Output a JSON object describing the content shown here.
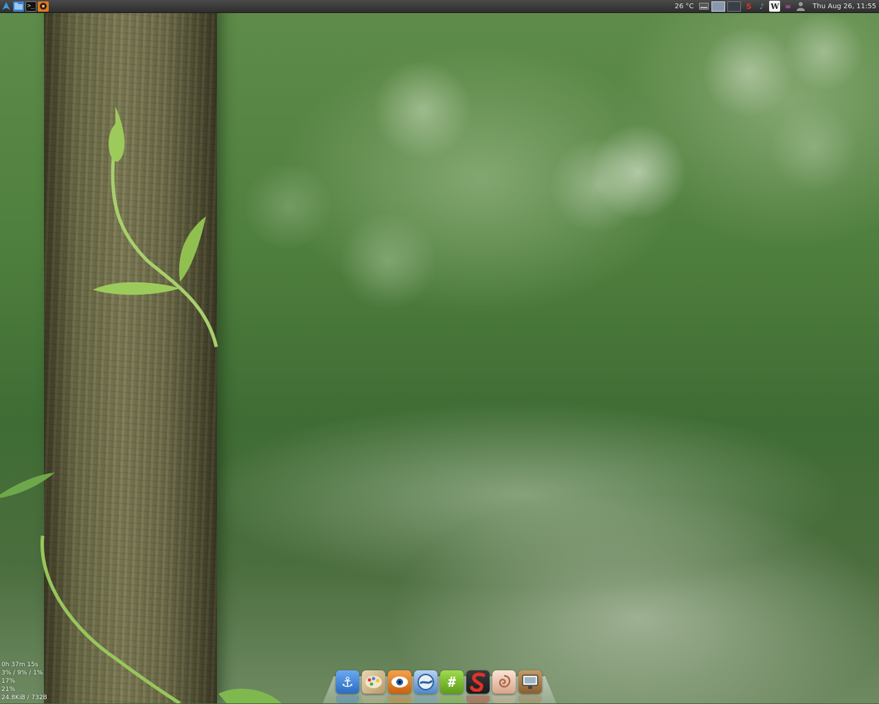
{
  "top_panel": {
    "launchers": [
      {
        "name": "arch-menu-icon"
      },
      {
        "name": "file-manager-icon"
      },
      {
        "name": "terminal-icon"
      },
      {
        "name": "media-player-icon"
      }
    ],
    "temperature": "26 °C",
    "workspaces": [
      {
        "name": "workspace-1",
        "active": true
      },
      {
        "name": "workspace-2",
        "active": false
      }
    ],
    "tray": [
      {
        "name": "scrobbler-icon",
        "glyph": "S",
        "color": "#e0322b"
      },
      {
        "name": "music-note-icon",
        "glyph": "♪",
        "color": "#5aa0e6"
      },
      {
        "name": "wikipedia-icon",
        "glyph": "W",
        "color": "#ffffff"
      },
      {
        "name": "messenger-icon",
        "glyph": "∞",
        "color": "#d64fcf"
      },
      {
        "name": "user-icon",
        "glyph": "●",
        "color": "#9a9a9a"
      }
    ],
    "clock": "Thu Aug 26, 11:55"
  },
  "system_stats": {
    "uptime": "0h 37m 15s",
    "cpu": "3% / 9% / 1%",
    "memory": "17%",
    "disk": "21%",
    "network": "24.8KiB / 732B"
  },
  "dock": {
    "items": [
      {
        "name": "dock-anchor-icon",
        "glyph": "⚓",
        "bg": "#3d7ed6"
      },
      {
        "name": "dock-paint-icon",
        "glyph": "✎",
        "bg": "#c9b48a"
      },
      {
        "name": "dock-eye-icon",
        "glyph": "◉",
        "bg": "#e07b1e"
      },
      {
        "name": "dock-browser-icon",
        "glyph": "◐",
        "bg": "#6e9fd6"
      },
      {
        "name": "dock-irc-icon",
        "glyph": "#",
        "bg": "#7cc22e"
      },
      {
        "name": "dock-scrobbler-icon",
        "glyph": "S",
        "bg": "#c62a25"
      },
      {
        "name": "dock-shell-icon",
        "glyph": "@",
        "bg": "#e8b9a0"
      },
      {
        "name": "dock-monitor-icon",
        "glyph": "▭",
        "bg": "#a87a47"
      }
    ]
  }
}
